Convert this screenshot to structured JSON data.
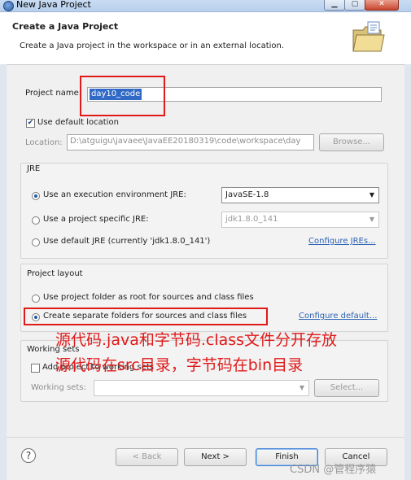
{
  "window": {
    "title": "New Java Project",
    "controls": [
      "minimize-icon",
      "maximize-icon",
      "close-icon"
    ]
  },
  "header": {
    "title": "Create a Java Project",
    "description": "Create a Java project in the workspace or in an external location.",
    "icon": "folder-icon"
  },
  "project_name": {
    "label": "Project name:",
    "value": "day10_code"
  },
  "location": {
    "default_checkbox": {
      "label": "Use default location",
      "checked": true
    },
    "label": "Location:",
    "value": "D:\\atguigu\\javaee\\JavaEE20180319\\code\\workspace\\day",
    "browse_label": "Browse..."
  },
  "jre": {
    "group_label": "JRE",
    "options": [
      {
        "label": "Use an execution environment JRE:",
        "selected": true,
        "combo_value": "JavaSE-1.8"
      },
      {
        "label": "Use a project specific JRE:",
        "selected": false,
        "combo_value": "jdk1.8.0_141"
      },
      {
        "label": "Use default JRE (currently 'jdk1.8.0_141')",
        "selected": false,
        "link": "Configure JREs..."
      }
    ]
  },
  "layout": {
    "group_label": "Project layout",
    "options": [
      {
        "label": "Use project folder as root for sources and class files",
        "selected": false
      },
      {
        "label": "Create separate folders for sources and class files",
        "selected": true,
        "link": "Configure default..."
      }
    ]
  },
  "working_sets": {
    "group_label": "Working sets",
    "add_label": "Add project to working sets",
    "sets_label": "Working sets:",
    "select_label": "Select..."
  },
  "annotations": {
    "line1": "源代码.java和字节码.class文件分开存放",
    "line2": "源代码在src目录，字节码在bin目录"
  },
  "buttons": {
    "help_icon": "help-icon",
    "back": "< Back",
    "next": "Next >",
    "finish": "Finish",
    "cancel": "Cancel"
  },
  "watermark": "CSDN @管程序猿"
}
